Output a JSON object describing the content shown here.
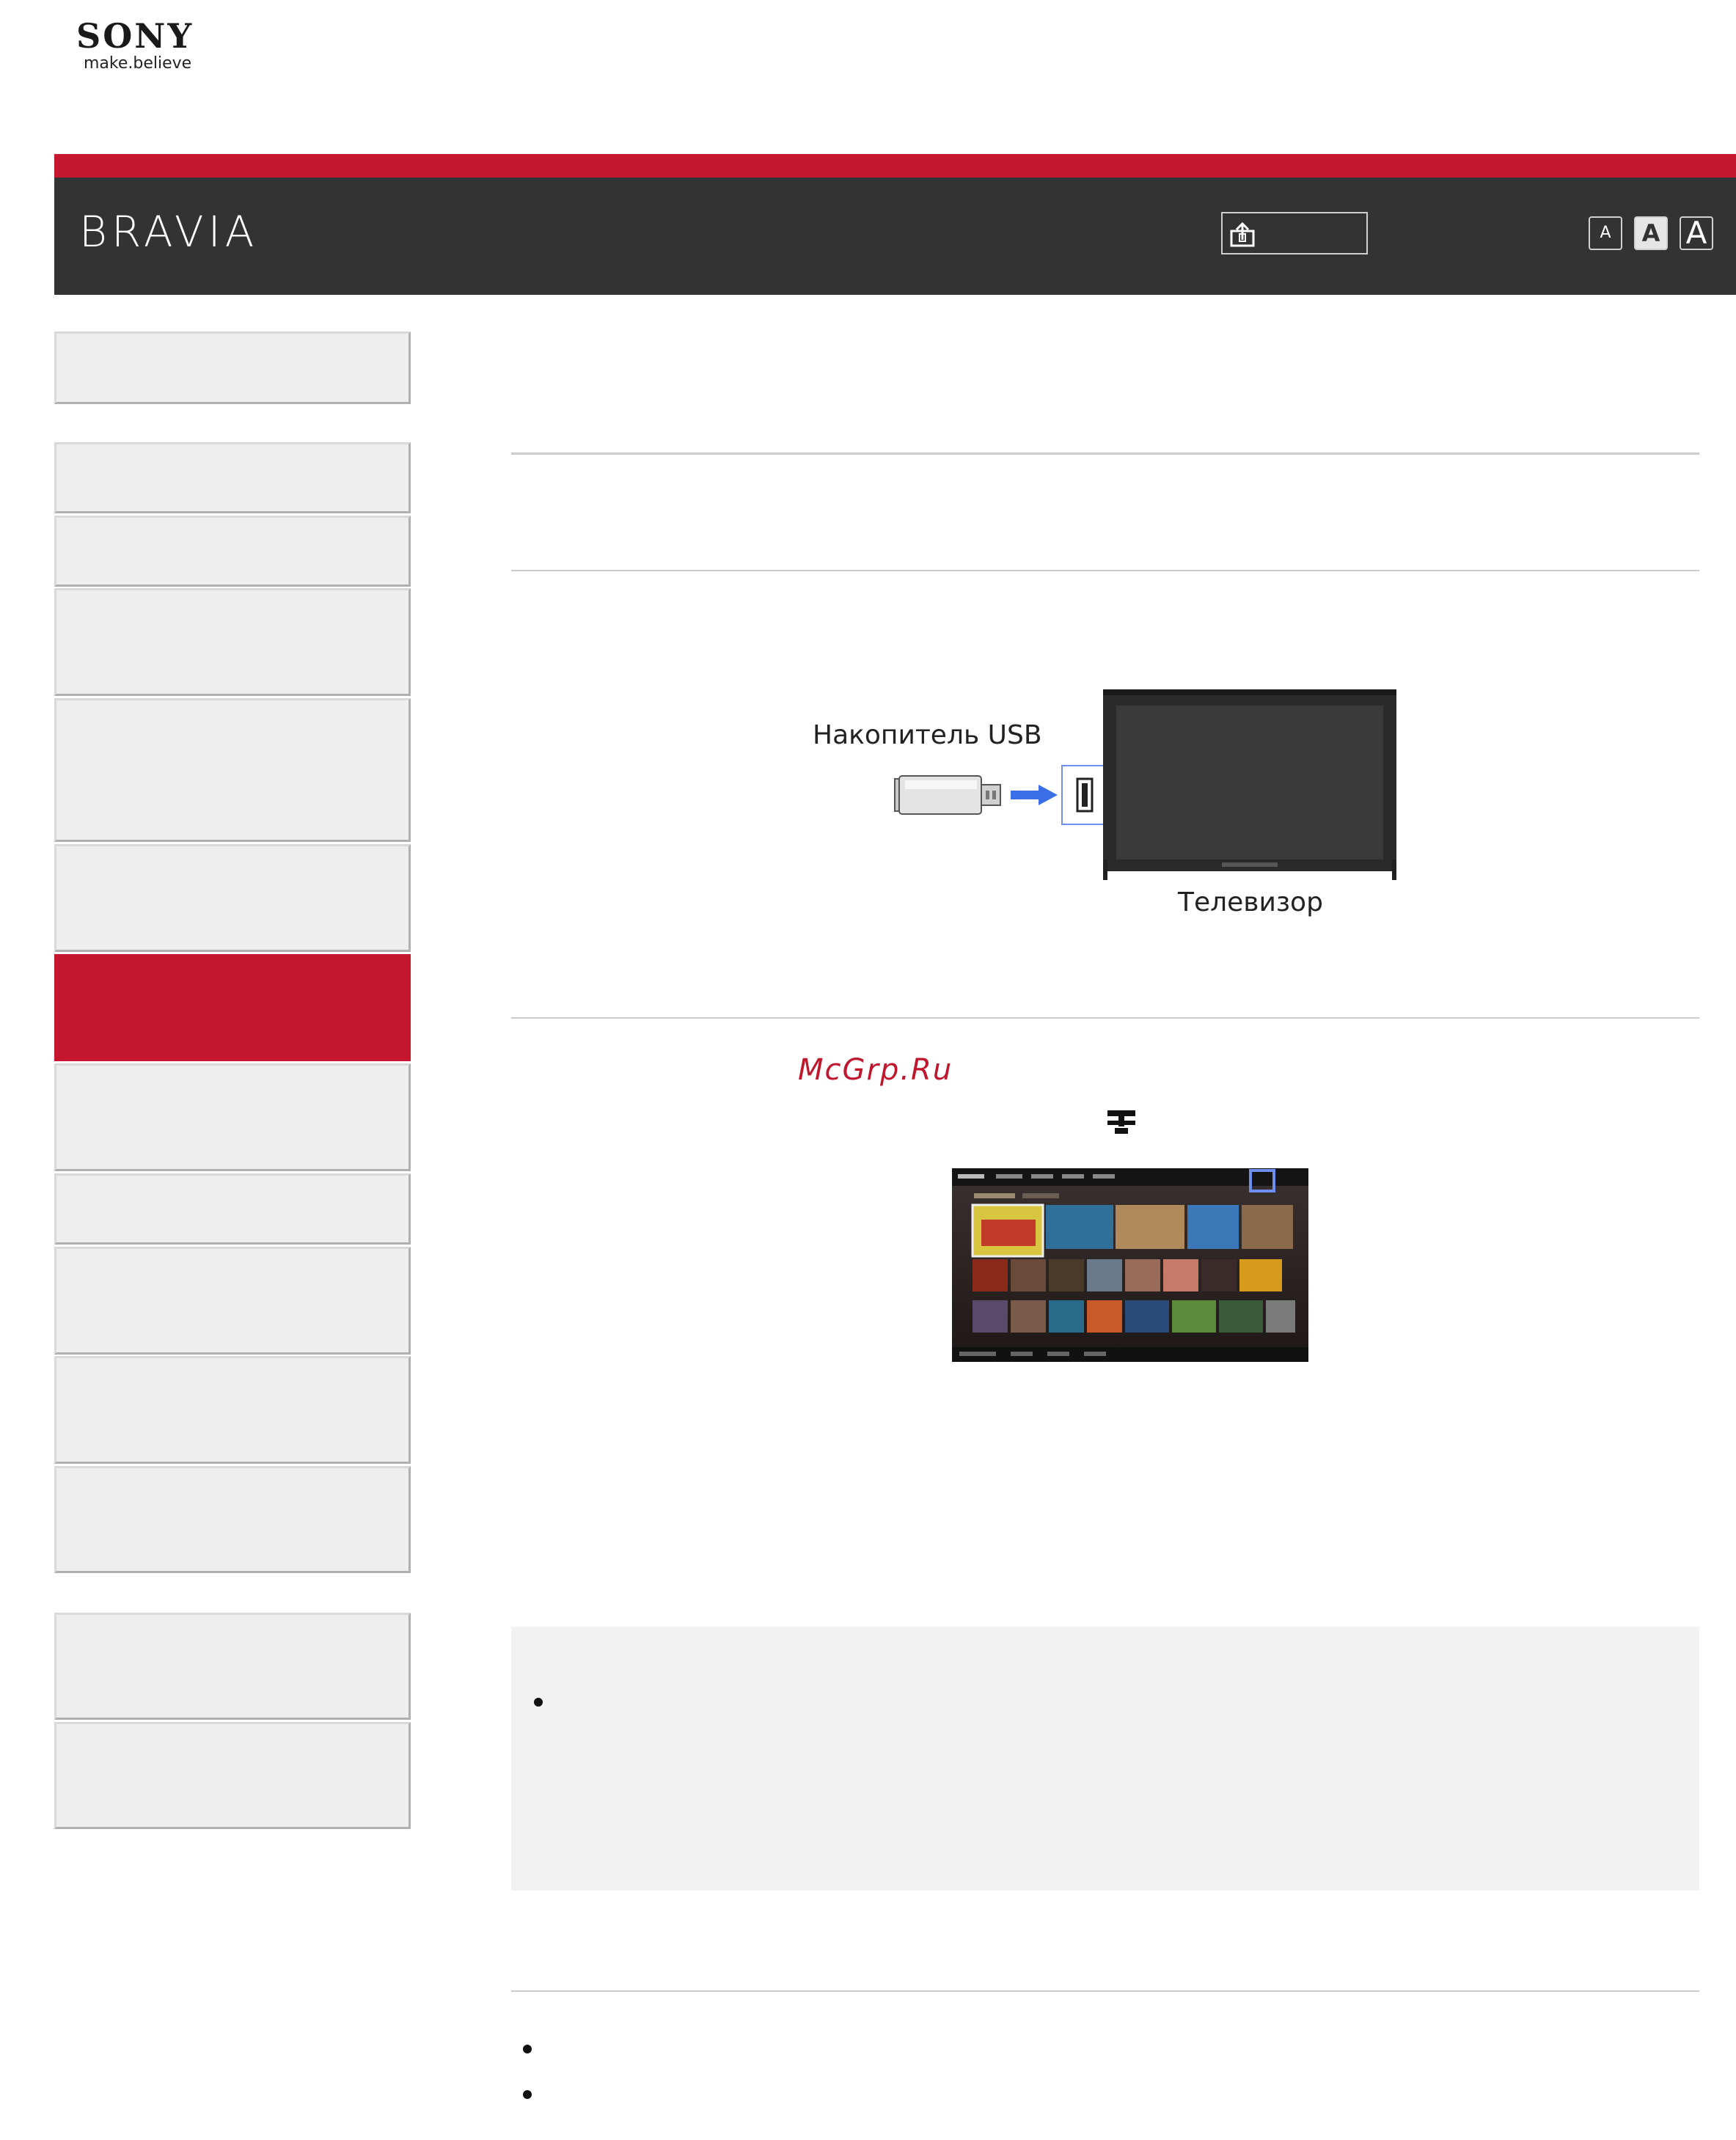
{
  "brand": {
    "company": "SONY",
    "tagline": "make.believe",
    "product": "BRAVIA",
    "accent_color": "#c5172f",
    "header_color": "#333333"
  },
  "toolbar": {
    "share_icon": "share-icon",
    "font_sizes": [
      "A",
      "A",
      "A"
    ]
  },
  "sidebar": {
    "items": [
      {
        "state": "normal"
      },
      {
        "state": "normal"
      },
      {
        "state": "normal"
      },
      {
        "state": "normal"
      },
      {
        "state": "normal"
      },
      {
        "state": "normal"
      },
      {
        "state": "active"
      },
      {
        "state": "normal"
      },
      {
        "state": "normal"
      },
      {
        "state": "normal"
      },
      {
        "state": "normal"
      },
      {
        "state": "normal"
      },
      {
        "state": "normal"
      },
      {
        "state": "normal"
      }
    ]
  },
  "diagram": {
    "usb_label": "Накопитель USB",
    "tv_label": "Телевизор"
  },
  "watermark": "McGrp.Ru",
  "icons": {
    "network": "network-icon"
  }
}
